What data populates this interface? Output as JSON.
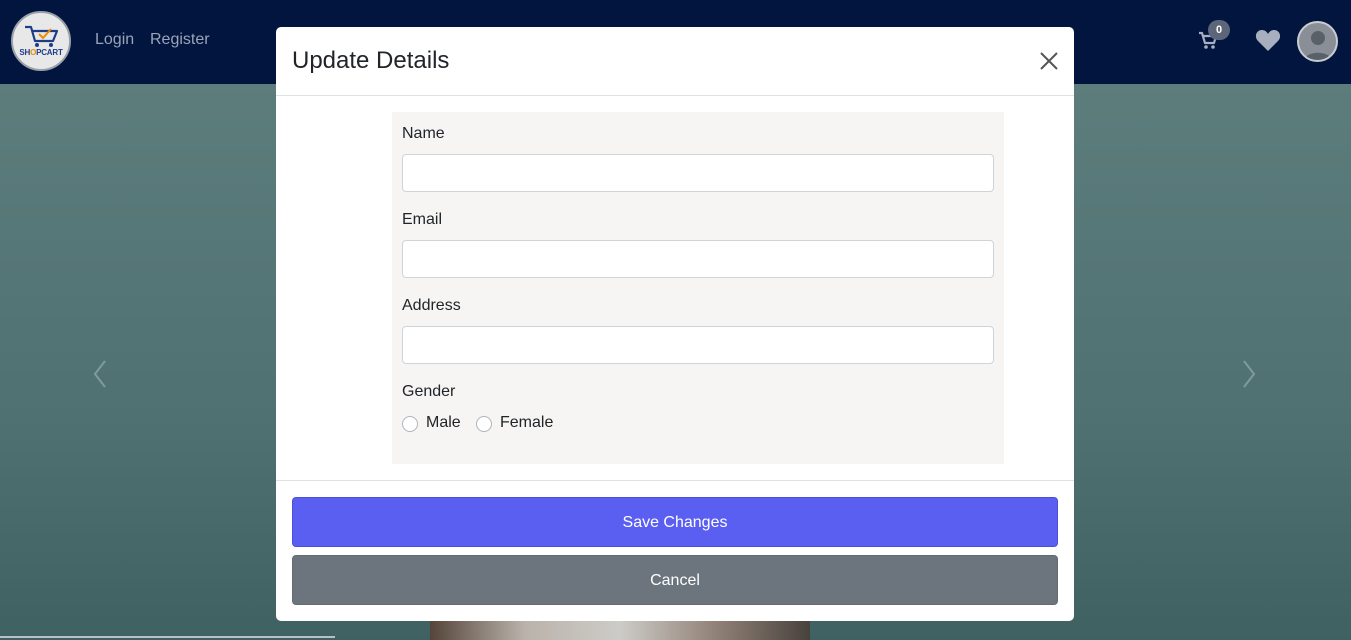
{
  "nav": {
    "logo_text_a": "SH",
    "logo_text_o": "O",
    "logo_text_b": "PCART",
    "login": "Login",
    "register": "Register",
    "cart_count": "0",
    "icons": [
      "cart-icon",
      "heart-icon",
      "user-avatar-icon"
    ]
  },
  "hero": {
    "icons": [
      "chevron-left-icon",
      "chevron-right-icon"
    ]
  },
  "modal": {
    "title": "Update Details",
    "close_icon": "close-icon",
    "fields": {
      "name_label": "Name",
      "name_value": "",
      "email_label": "Email",
      "email_value": "",
      "address_label": "Address",
      "address_value": "",
      "gender_label": "Gender",
      "gender_male": "Male",
      "gender_female": "Female"
    },
    "save_label": "Save Changes",
    "cancel_label": "Cancel"
  },
  "colors": {
    "navbar": "#02153f",
    "save_button": "#5b5ff1",
    "cancel_button": "#6c757d"
  }
}
